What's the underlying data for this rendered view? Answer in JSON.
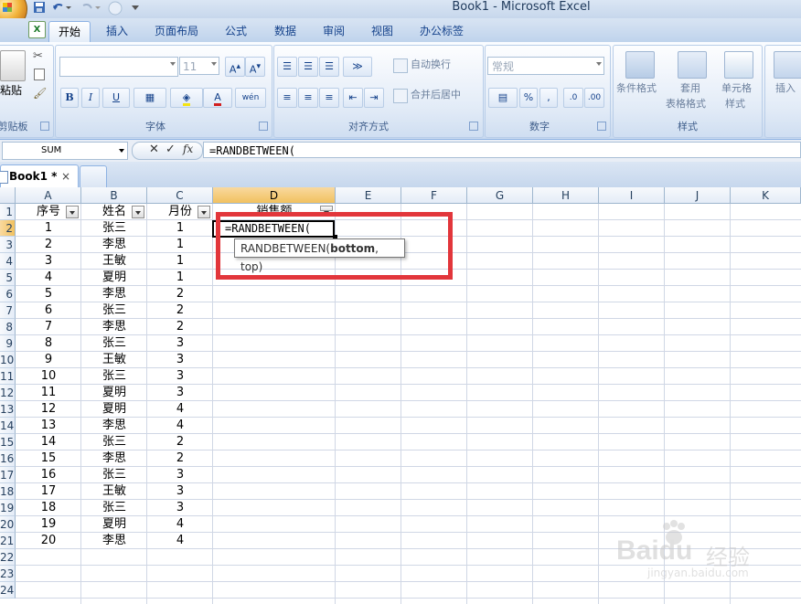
{
  "window": {
    "title": "Book1 - Microsoft Excel"
  },
  "ribbon": {
    "tabs": [
      "开始",
      "插入",
      "页面布局",
      "公式",
      "数据",
      "审阅",
      "视图",
      "办公标签"
    ],
    "active_tab": "开始",
    "clipboard": {
      "paste_label": "粘贴",
      "group_label": "剪贴板"
    },
    "font": {
      "name_value": "",
      "size_value": "11",
      "group_label": "字体",
      "bold": "B",
      "italic": "I",
      "underline": "U",
      "font_color": "A",
      "wen": "wén"
    },
    "alignment": {
      "wrap_text": "自动换行",
      "merge_center": "合并后居中",
      "group_label": "对齐方式"
    },
    "number": {
      "format_value": "常规",
      "percent": "%",
      "comma": ",",
      "group_label": "数字"
    },
    "styles": {
      "conditional": "条件格式",
      "table_format_1": "套用",
      "table_format_2": "表格格式",
      "cell_styles_1": "单元格",
      "cell_styles_2": "样式",
      "group_label": "样式"
    },
    "cells": {
      "insert": "插入"
    }
  },
  "formula_bar": {
    "name_box": "SUM",
    "cancel": "✕",
    "enter": "✓",
    "fx": "fx",
    "formula": "=RANDBETWEEN("
  },
  "workbook": {
    "tab_label": "Book1 *",
    "close": "×"
  },
  "sheet": {
    "columns": [
      "A",
      "B",
      "C",
      "D",
      "E",
      "F",
      "G",
      "H",
      "I",
      "J",
      "K"
    ],
    "row_numbers": [
      "1",
      "2",
      "3",
      "4",
      "5",
      "6",
      "7",
      "8",
      "9",
      "10",
      "11",
      "12",
      "13",
      "14",
      "15",
      "16",
      "17",
      "18",
      "19",
      "20",
      "21",
      "22",
      "23",
      "24"
    ],
    "headers": [
      "序号",
      "姓名",
      "月份",
      "销售额"
    ],
    "rows": [
      [
        "1",
        "张三",
        "1"
      ],
      [
        "2",
        "李思",
        "1"
      ],
      [
        "3",
        "王敏",
        "1"
      ],
      [
        "4",
        "夏明",
        "1"
      ],
      [
        "5",
        "李思",
        "2"
      ],
      [
        "6",
        "张三",
        "2"
      ],
      [
        "7",
        "李思",
        "2"
      ],
      [
        "8",
        "张三",
        "3"
      ],
      [
        "9",
        "王敏",
        "3"
      ],
      [
        "10",
        "张三",
        "3"
      ],
      [
        "11",
        "夏明",
        "3"
      ],
      [
        "12",
        "夏明",
        "4"
      ],
      [
        "13",
        "李思",
        "4"
      ],
      [
        "14",
        "张三",
        "2"
      ],
      [
        "15",
        "李思",
        "2"
      ],
      [
        "16",
        "张三",
        "3"
      ],
      [
        "17",
        "王敏",
        "3"
      ],
      [
        "18",
        "张三",
        "3"
      ],
      [
        "19",
        "夏明",
        "4"
      ],
      [
        "20",
        "李思",
        "4"
      ]
    ],
    "active_cell_text": "=RANDBETWEEN(",
    "tooltip": {
      "func": "RANDBETWEEN(",
      "arg1": "bottom",
      "rest": ", top)"
    }
  },
  "watermark": {
    "brand": "Baidu",
    "cn": "经验",
    "url": "jingyan.baidu.com"
  },
  "colors": {
    "highlight": "#e2363b",
    "ribbon_blue": "#15428b"
  }
}
